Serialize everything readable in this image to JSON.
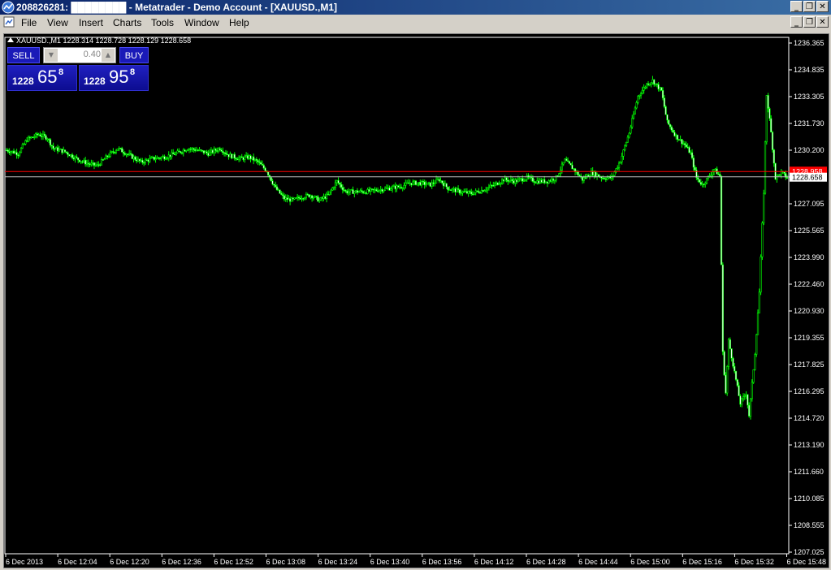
{
  "window": {
    "title": "208826281: ████████ - Metatrader - Demo Account - [XAUUSD.,M1]",
    "controls": [
      "_",
      "❐",
      "✕"
    ]
  },
  "menu": {
    "items": [
      "File",
      "View",
      "Insert",
      "Charts",
      "Tools",
      "Window",
      "Help"
    ],
    "controls": [
      "_",
      "❐",
      "✕"
    ]
  },
  "one_click": {
    "sell_label": "SELL",
    "buy_label": "BUY",
    "lot": "0.40",
    "sell_price": {
      "a": "1228",
      "b": "65",
      "c": "8"
    },
    "buy_price": {
      "a": "1228",
      "b": "95",
      "c": "8"
    },
    "colors": {
      "panel": "#1a1ab8"
    }
  },
  "chart_data": {
    "type": "candlestick",
    "symbol_header": "XAUUSD.,M1  1228.314 1228.728 1228.129 1228.658",
    "y_ticks": [
      "1236.365",
      "1234.835",
      "1233.305",
      "1231.730",
      "1230.200",
      "1228.658",
      "1227.095",
      "1225.565",
      "1223.990",
      "1222.460",
      "1220.930",
      "1219.355",
      "1217.825",
      "1216.295",
      "1214.720",
      "1213.190",
      "1211.660",
      "1210.085",
      "1208.555",
      "1207.025"
    ],
    "ylim": [
      1207.025,
      1236.365
    ],
    "x_ticks": [
      "6 Dec 2013",
      "6 Dec 12:04",
      "6 Dec 12:20",
      "6 Dec 12:36",
      "6 Dec 12:52",
      "6 Dec 13:08",
      "6 Dec 13:24",
      "6 Dec 13:40",
      "6 Dec 13:56",
      "6 Dec 14:12",
      "6 Dec 14:28",
      "6 Dec 14:44",
      "6 Dec 15:00",
      "6 Dec 15:16",
      "6 Dec 15:32",
      "6 Dec 15:48"
    ],
    "bid_line": 1228.658,
    "ask_line": 1228.958,
    "ask_label": "1228.958",
    "bid_label": "1228.658",
    "price_path": [
      [
        0,
        1230.2
      ],
      [
        8,
        1230.0
      ],
      [
        14,
        1230.8
      ],
      [
        22,
        1231.1
      ],
      [
        28,
        1230.9
      ],
      [
        32,
        1230.3
      ],
      [
        40,
        1230.1
      ],
      [
        48,
        1229.7
      ],
      [
        56,
        1229.4
      ],
      [
        62,
        1229.3
      ],
      [
        70,
        1229.9
      ],
      [
        76,
        1230.3
      ],
      [
        84,
        1229.9
      ],
      [
        92,
        1229.5
      ],
      [
        100,
        1229.7
      ],
      [
        108,
        1229.8
      ],
      [
        116,
        1230.0
      ],
      [
        124,
        1230.3
      ],
      [
        130,
        1230.2
      ],
      [
        138,
        1230.0
      ],
      [
        146,
        1230.3
      ],
      [
        152,
        1229.9
      ],
      [
        160,
        1229.7
      ],
      [
        166,
        1229.8
      ],
      [
        172,
        1229.5
      ],
      [
        178,
        1229.0
      ],
      [
        184,
        1228.0
      ],
      [
        190,
        1227.4
      ],
      [
        196,
        1227.3
      ],
      [
        202,
        1227.5
      ],
      [
        208,
        1227.6
      ],
      [
        214,
        1227.3
      ],
      [
        220,
        1227.6
      ],
      [
        226,
        1228.4
      ],
      [
        232,
        1227.8
      ],
      [
        238,
        1227.8
      ],
      [
        246,
        1227.8
      ],
      [
        254,
        1227.9
      ],
      [
        262,
        1228.0
      ],
      [
        270,
        1228.1
      ],
      [
        276,
        1228.3
      ],
      [
        282,
        1228.3
      ],
      [
        290,
        1228.2
      ],
      [
        296,
        1228.5
      ],
      [
        302,
        1228.0
      ],
      [
        310,
        1227.8
      ],
      [
        318,
        1227.7
      ],
      [
        326,
        1227.9
      ],
      [
        334,
        1228.2
      ],
      [
        340,
        1228.5
      ],
      [
        348,
        1228.4
      ],
      [
        356,
        1228.6
      ],
      [
        362,
        1228.4
      ],
      [
        370,
        1228.4
      ],
      [
        376,
        1228.6
      ],
      [
        382,
        1229.6
      ],
      [
        388,
        1229.1
      ],
      [
        394,
        1228.5
      ],
      [
        400,
        1228.9
      ],
      [
        408,
        1228.6
      ],
      [
        414,
        1228.6
      ],
      [
        420,
        1229.6
      ],
      [
        426,
        1231.2
      ],
      [
        432,
        1233.3
      ],
      [
        438,
        1234.0
      ],
      [
        442,
        1234.2
      ],
      [
        448,
        1233.6
      ],
      [
        452,
        1231.8
      ],
      [
        458,
        1231.0
      ],
      [
        464,
        1230.5
      ],
      [
        468,
        1230.0
      ],
      [
        472,
        1228.6
      ],
      [
        476,
        1228.2
      ],
      [
        480,
        1228.6
      ],
      [
        484,
        1229.1
      ],
      [
        488,
        1228.7
      ],
      [
        490,
        1218.5
      ],
      [
        492,
        1216.2
      ],
      [
        494,
        1219.2
      ],
      [
        498,
        1217.4
      ],
      [
        502,
        1215.6
      ],
      [
        506,
        1216.2
      ],
      [
        508,
        1214.9
      ],
      [
        512,
        1218.5
      ],
      [
        515,
        1222.0
      ],
      [
        518,
        1227.8
      ],
      [
        520,
        1233.4
      ],
      [
        523,
        1231.2
      ],
      [
        526,
        1228.6
      ],
      [
        530,
        1228.9
      ],
      [
        534,
        1228.6
      ]
    ]
  }
}
